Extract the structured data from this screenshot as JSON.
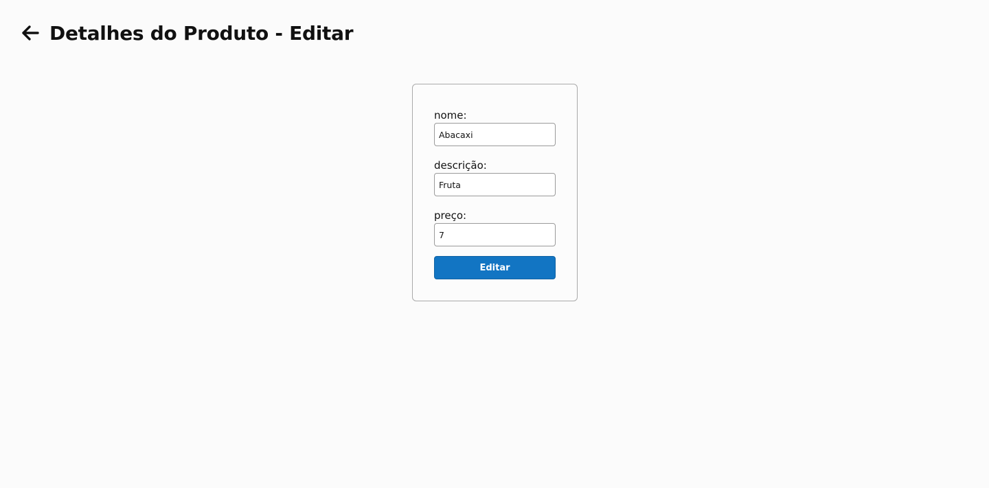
{
  "header": {
    "back_icon": "arrow-left-icon",
    "title": "Detalhes do Produto - Editar"
  },
  "form": {
    "fields": [
      {
        "label": "nome:",
        "value": "Abacaxi"
      },
      {
        "label": "descrição:",
        "value": "Fruta"
      },
      {
        "label": "preço:",
        "value": "7"
      }
    ],
    "submit_label": "Editar"
  },
  "colors": {
    "accent": "#1275c3",
    "background": "#fbfbfb",
    "border": "#a9a9a9"
  }
}
